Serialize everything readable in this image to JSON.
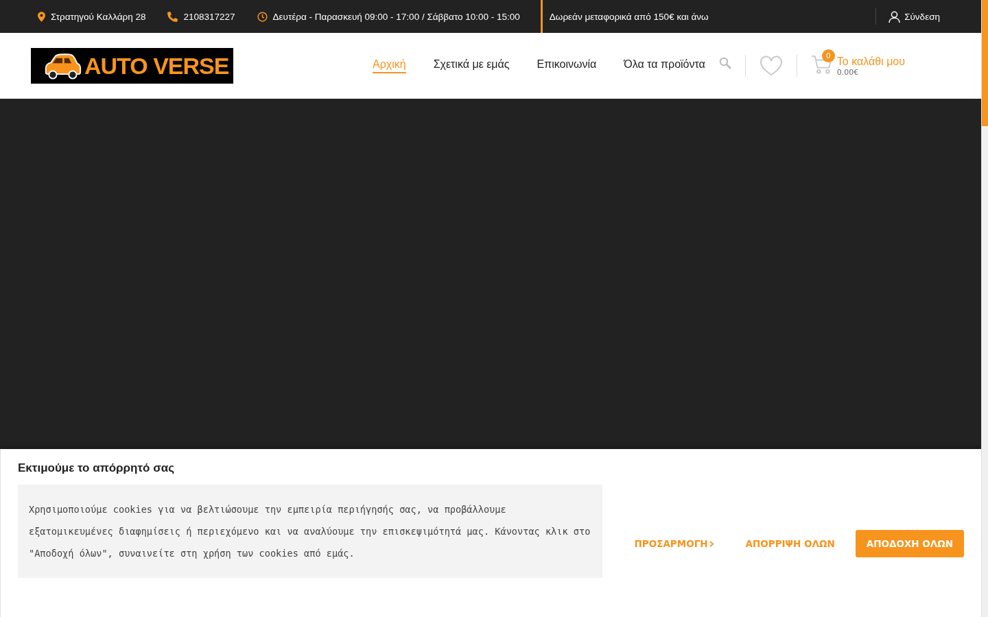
{
  "top_bar": {
    "address": "Στρατηγού Καλλάρη 28",
    "phone": "2108317227",
    "hours": "Δευτέρα - Παρασκευή 09:00 - 17:00 / Σάββατο 10:00 - 15:00",
    "shipping": "Δωρεάν μεταφορικά από 150€ και άνω",
    "login": "Σύνδεση"
  },
  "header": {
    "logo_text": "AUTO VERSE",
    "nav": [
      {
        "label": "Αρχική",
        "selected": true
      },
      {
        "label": "Σχετικά με εμάς",
        "selected": false
      },
      {
        "label": "Επικοινωνία",
        "selected": false
      },
      {
        "label": "Όλα τα προϊόντα",
        "selected": false
      }
    ],
    "cart": {
      "count": "0",
      "title": "Το καλάθι μου",
      "total": "0.00€"
    }
  },
  "cookie_banner": {
    "title": "Εκτιμούμε το απόρρητό σας",
    "text": "Χρησιμοποιούμε cookies για να βελτιώσουμε την εμπειρία περιήγησής σας, να προβάλλουμε εξατομικευμένες διαφημίσεις ή περιεχόμενο και να αναλύουμε την επισκεψιμότητά μας. Κάνοντας κλικ στο \"Αποδοχή όλων\", συναινείτε στη χρήση των cookies από εμάς.",
    "buttons": [
      {
        "label": "ΠΡΟΣΑΡΜΟΓΗ",
        "kind": "customize"
      },
      {
        "label": "ΑΠΟΡΡΙΨΗ ΟΛΩΝ",
        "kind": "text"
      },
      {
        "label": "ΑΠΟΔΟΧΗ ΟΛΩΝ",
        "kind": "primary"
      }
    ]
  }
}
